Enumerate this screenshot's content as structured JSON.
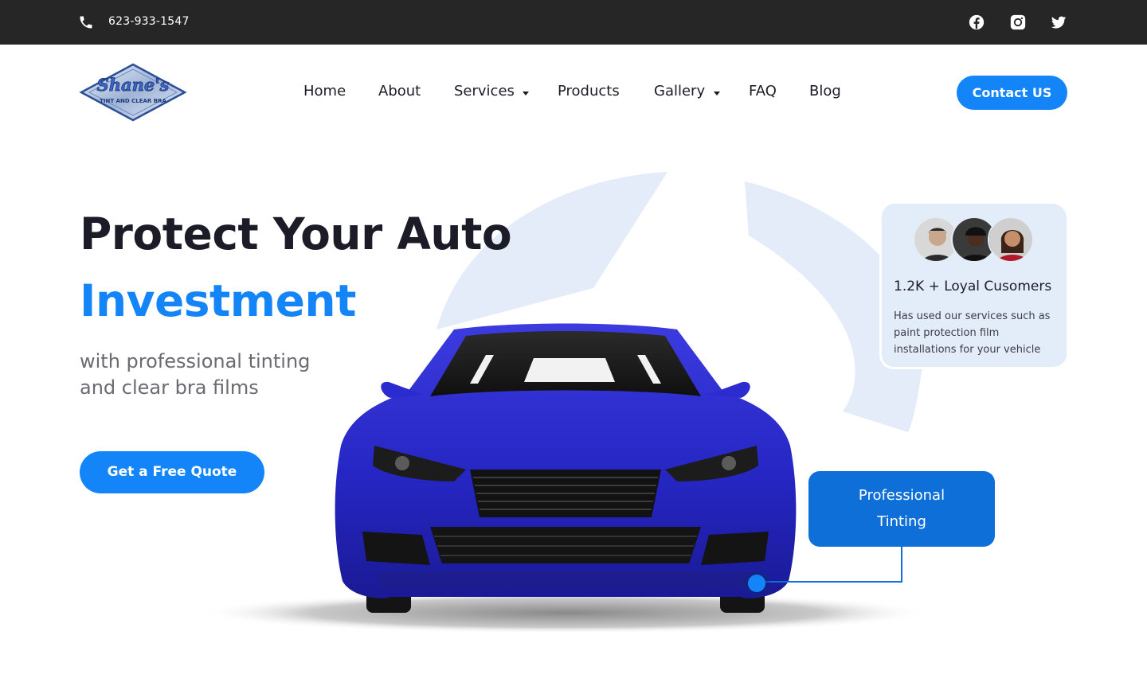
{
  "topbar": {
    "phone": "623-933-1547",
    "phone_icon": "phone-icon",
    "social": [
      "facebook-icon",
      "instagram-icon",
      "twitter-icon"
    ]
  },
  "header": {
    "logo_text": "Shane's",
    "logo_subtext": "TINT AND CLEAR BRA",
    "nav": [
      {
        "label": "Home"
      },
      {
        "label": "About"
      },
      {
        "label": "Services",
        "dropdown": true
      },
      {
        "label": "Products"
      },
      {
        "label": "Gallery",
        "dropdown": true
      },
      {
        "label": "FAQ"
      },
      {
        "label": "Blog"
      }
    ],
    "contact_button": "Contact US"
  },
  "hero": {
    "title_line1": "Protect Your Auto",
    "title_line2": "Investment",
    "subtitle": "with professional tinting and clear bra films",
    "cta": "Get a Free Quote"
  },
  "customers_card": {
    "title": "1.2K + Loyal Cusomers",
    "description": "Has used our services such as  paint protection film installations for your vehicle"
  },
  "feature_tag": {
    "line1": "Professional",
    "line2": "Tinting"
  },
  "colors": {
    "accent": "#1385f8",
    "dark": "#262626",
    "card_bg": "#e3edf9",
    "car_blue": "#2a2ad0"
  }
}
